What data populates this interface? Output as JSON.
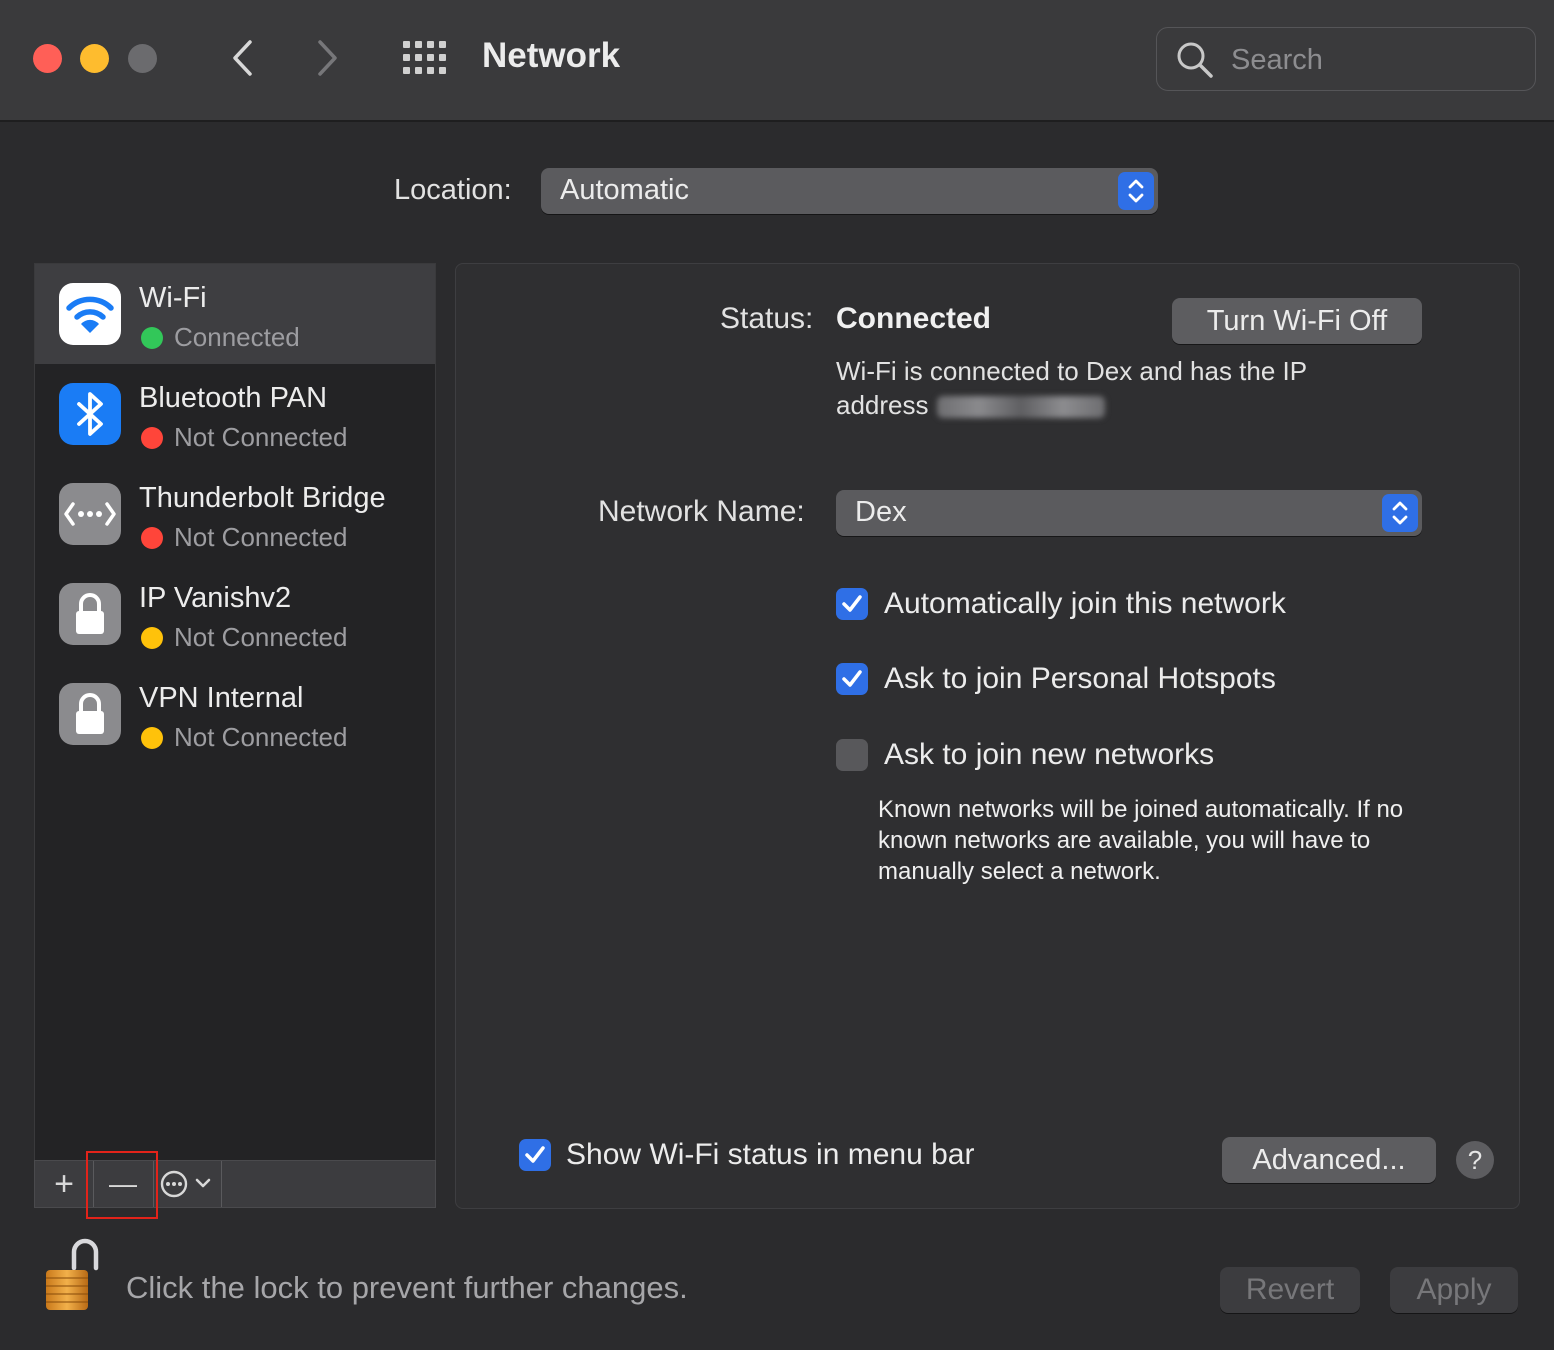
{
  "window": {
    "title": "Network",
    "search_placeholder": "Search",
    "traffic_lights": {
      "close": "#ff5f57",
      "minimize": "#febc2e",
      "zoom": "#6b6b6e"
    }
  },
  "location": {
    "label": "Location:",
    "value": "Automatic"
  },
  "services": [
    {
      "name": "Wi-Fi",
      "status": "Connected",
      "status_color": "#32c759",
      "icon": "wifi-icon",
      "selected": true
    },
    {
      "name": "Bluetooth PAN",
      "status": "Not Connected",
      "status_color": "#ff453a",
      "icon": "bluetooth-icon"
    },
    {
      "name": "Thunderbolt Bridge",
      "status": "Not Connected",
      "status_color": "#ff453a",
      "icon": "thunderbolt-bridge-icon"
    },
    {
      "name": "IP Vanishv2",
      "status": "Not Connected",
      "status_color": "#ffc20a",
      "icon": "lock-icon"
    },
    {
      "name": "VPN Internal",
      "status": "Not Connected",
      "status_color": "#ffc20a",
      "icon": "lock-icon"
    }
  ],
  "sidebar_footer": {
    "add_label": "+",
    "remove_label": "—",
    "action_icon": "ellipsis-circle-icon"
  },
  "detail": {
    "status_label": "Status:",
    "status_value": "Connected",
    "toggle_wifi_label": "Turn Wi-Fi Off",
    "description": "Wi-Fi is connected to Dex and has the IP address",
    "network_name_label": "Network Name:",
    "network_name_value": "Dex",
    "checkboxes": [
      {
        "label": "Automatically join this network",
        "checked": true
      },
      {
        "label": "Ask to join Personal Hotspots",
        "checked": true
      },
      {
        "label": "Ask to join new networks",
        "checked": false
      }
    ],
    "note": "Known networks will be joined automatically. If no known networks are available, you will have to manually select a network.",
    "show_status_label": "Show Wi-Fi status in menu bar",
    "show_status_checked": true,
    "advanced_label": "Advanced...",
    "help_label": "?"
  },
  "footer": {
    "lock_text": "Click the lock to prevent further changes.",
    "revert_label": "Revert",
    "apply_label": "Apply"
  },
  "colors": {
    "accent": "#2f6fe6",
    "wifi_icon_bg": "#ffffff",
    "bluetooth_icon_bg": "#1a7cf5",
    "gray_icon_bg": "#8b8b8e"
  }
}
